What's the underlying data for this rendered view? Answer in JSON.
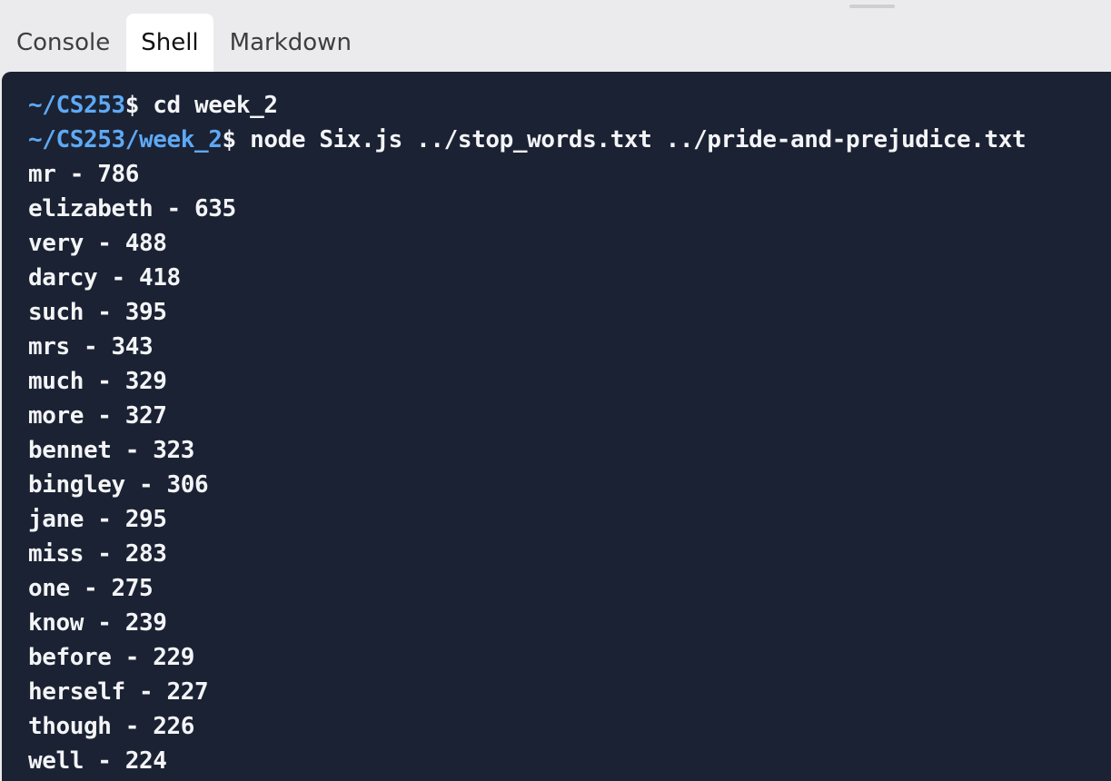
{
  "tabs": [
    {
      "label": "Console",
      "active": false
    },
    {
      "label": "Shell",
      "active": true
    },
    {
      "label": "Markdown",
      "active": false
    }
  ],
  "terminal": {
    "commands": [
      {
        "path": "~/CS253",
        "prompt": "$ ",
        "command": "cd week_2"
      },
      {
        "path": "~/CS253/week_2",
        "prompt": "$ ",
        "command": "node Six.js ../stop_words.txt ../pride-and-prejudice.txt"
      }
    ],
    "output": [
      "mr - 786",
      "elizabeth - 635",
      "very - 488",
      "darcy - 418",
      "such - 395",
      "mrs - 343",
      "much - 329",
      "more - 327",
      "bennet - 323",
      "bingley - 306",
      "jane - 295",
      "miss - 283",
      "one - 275",
      "know - 239",
      "before - 229",
      "herself - 227",
      "though - 226",
      "well - 224"
    ]
  },
  "colors": {
    "terminal_bg": "#1b2233",
    "path": "#5ea9f5",
    "text": "#f3f4f6"
  }
}
